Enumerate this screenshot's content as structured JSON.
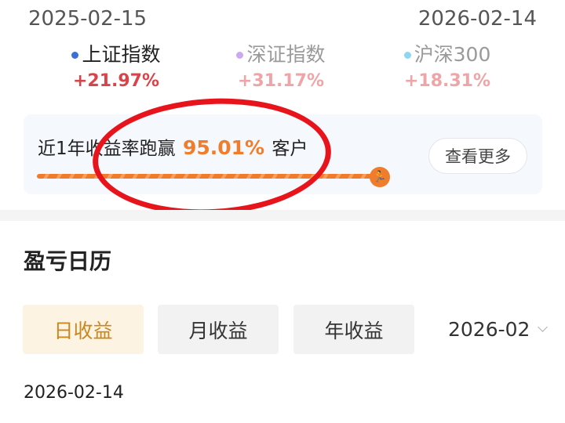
{
  "date_range": {
    "start": "2025-02-15",
    "end": "2026-02-14"
  },
  "indices": [
    {
      "name": "上证指数",
      "value": "+21.97%",
      "dot_color": "#3a6fd8"
    },
    {
      "name": "深证指数",
      "value": "+31.17%",
      "dot_color": "#c9a9f0"
    },
    {
      "name": "沪深300",
      "value": "+18.31%",
      "dot_color": "#8fd6f2"
    }
  ],
  "rank_card": {
    "text_prefix": "近1年收益率跑赢",
    "percent": "95.01%",
    "text_suffix": "客户",
    "more_label": "查看更多",
    "progress": 0.95
  },
  "calendar": {
    "title": "盈亏日历",
    "tabs": [
      "日收益",
      "月收益",
      "年收益"
    ],
    "active_tab": "日收益",
    "month_value": "2026-02",
    "day_label": "2026-02-14"
  }
}
